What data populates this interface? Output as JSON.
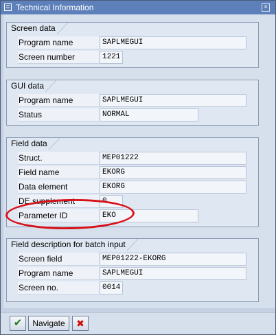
{
  "window": {
    "title": "Technical Information",
    "close_glyph": "×"
  },
  "screen_data": {
    "title": "Screen data",
    "program_name_label": "Program name",
    "program_name_value": "SAPLMEGUI",
    "screen_number_label": "Screen number",
    "screen_number_value": "1221"
  },
  "gui_data": {
    "title": "GUI data",
    "program_name_label": "Program name",
    "program_name_value": "SAPLMEGUI",
    "status_label": "Status",
    "status_value": "NORMAL"
  },
  "field_data": {
    "title": "Field data",
    "struct_label": "Struct.",
    "struct_value": "MEP01222",
    "field_name_label": "Field name",
    "field_name_value": "EKORG",
    "data_element_label": "Data element",
    "data_element_value": "EKORG",
    "de_supplement_label": "DE supplement",
    "de_supplement_value": "0",
    "parameter_id_label": "Parameter ID",
    "parameter_id_value": "EKO"
  },
  "batch_input": {
    "title": "Field description for batch input",
    "screen_field_label": "Screen field",
    "screen_field_value": "MEP01222-EKORG",
    "program_name_label": "Program name",
    "program_name_value": "SAPLMEGUI",
    "screen_no_label": "Screen no.",
    "screen_no_value": "0014"
  },
  "footer": {
    "ok_glyph": "✔",
    "navigate_label": "Navigate",
    "cancel_glyph": "✖"
  },
  "colors": {
    "title_bar": "#5d80ba",
    "highlight_ellipse": "#d81018",
    "ok_icon": "#1f7a1f",
    "cancel_icon": "#cc1010"
  }
}
